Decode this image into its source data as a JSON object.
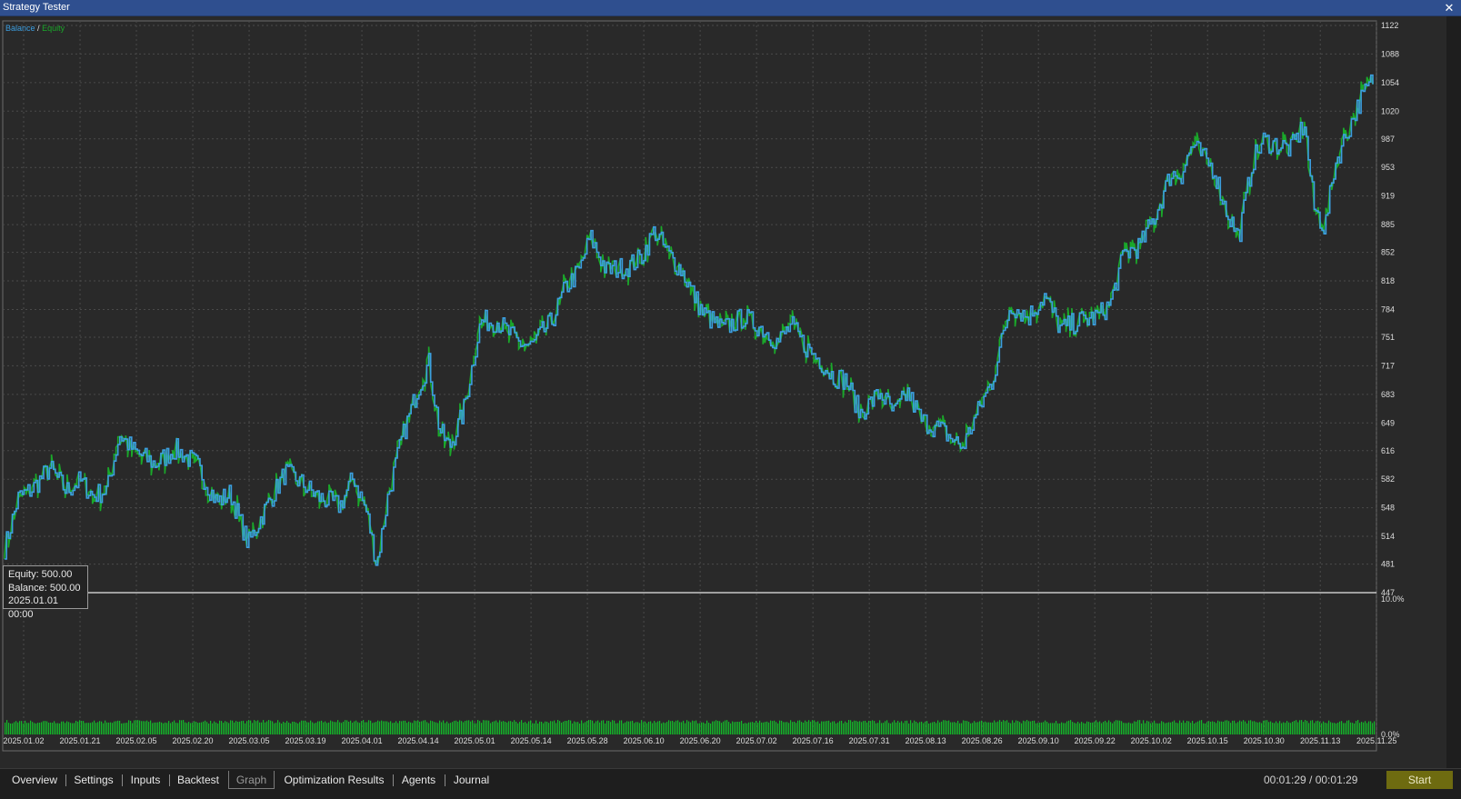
{
  "window": {
    "title": "Strategy Tester",
    "close_icon": "close-icon"
  },
  "legend": {
    "balance": "Balance",
    "separator": "/",
    "equity": "Equity"
  },
  "colors": {
    "balance": "#3c9ee0",
    "equity": "#1aa82a",
    "background": "#292929",
    "grid": "#4a4a4a",
    "start_button": "#6e6b10"
  },
  "infobox": {
    "equity": "Equity: 500.00",
    "balance": "Balance: 500.00",
    "datetime": "2025.01.01 00:00"
  },
  "tabs": [
    {
      "label": "Overview"
    },
    {
      "label": "Settings"
    },
    {
      "label": "Inputs"
    },
    {
      "label": "Backtest"
    },
    {
      "label": "Graph",
      "active": true
    },
    {
      "label": "Optimization Results"
    },
    {
      "label": "Agents"
    },
    {
      "label": "Journal"
    }
  ],
  "status": {
    "timer": "00:01:29 / 00:01:29",
    "start_label": "Start"
  },
  "chart_data": {
    "type": "line",
    "title": "",
    "series": [
      {
        "name": "Balance",
        "color": "#3c9ee0"
      },
      {
        "name": "Equity",
        "color": "#1aa82a"
      }
    ],
    "ylim": [
      447,
      1122
    ],
    "y_ticks": [
      "1122",
      "1088",
      "1054",
      "1020",
      "987",
      "953",
      "919",
      "885",
      "852",
      "818",
      "784",
      "751",
      "717",
      "683",
      "649",
      "616",
      "582",
      "548",
      "514",
      "481",
      "447"
    ],
    "x_ticks": [
      "2025.01.02",
      "2025.01.21",
      "2025.02.05",
      "2025.02.20",
      "2025.03.05",
      "2025.03.19",
      "2025.04.01",
      "2025.04.14",
      "2025.05.01",
      "2025.05.14",
      "2025.05.28",
      "2025.06.10",
      "2025.06.20",
      "2025.07.02",
      "2025.07.16",
      "2025.07.31",
      "2025.08.13",
      "2025.08.26",
      "2025.09.10",
      "2025.09.22",
      "2025.10.02",
      "2025.10.15",
      "2025.10.30",
      "2025.11.13",
      "2025.11.25"
    ],
    "profile": [
      [
        0,
        500
      ],
      [
        0.01,
        560
      ],
      [
        0.02,
        570
      ],
      [
        0.033,
        595
      ],
      [
        0.045,
        568
      ],
      [
        0.055,
        580
      ],
      [
        0.065,
        562
      ],
      [
        0.075,
        570
      ],
      [
        0.084,
        635
      ],
      [
        0.095,
        615
      ],
      [
        0.11,
        600
      ],
      [
        0.125,
        618
      ],
      [
        0.14,
        600
      ],
      [
        0.155,
        555
      ],
      [
        0.165,
        565
      ],
      [
        0.178,
        505
      ],
      [
        0.19,
        545
      ],
      [
        0.205,
        590
      ],
      [
        0.215,
        580
      ],
      [
        0.23,
        560
      ],
      [
        0.245,
        550
      ],
      [
        0.255,
        585
      ],
      [
        0.265,
        540
      ],
      [
        0.272,
        480
      ],
      [
        0.28,
        560
      ],
      [
        0.29,
        628
      ],
      [
        0.302,
        690
      ],
      [
        0.31,
        720
      ],
      [
        0.318,
        640
      ],
      [
        0.325,
        620
      ],
      [
        0.335,
        660
      ],
      [
        0.348,
        770
      ],
      [
        0.36,
        770
      ],
      [
        0.375,
        745
      ],
      [
        0.385,
        740
      ],
      [
        0.392,
        755
      ],
      [
        0.4,
        770
      ],
      [
        0.41,
        810
      ],
      [
        0.42,
        830
      ],
      [
        0.428,
        870
      ],
      [
        0.44,
        830
      ],
      [
        0.455,
        835
      ],
      [
        0.465,
        845
      ],
      [
        0.475,
        878
      ],
      [
        0.485,
        850
      ],
      [
        0.495,
        830
      ],
      [
        0.51,
        780
      ],
      [
        0.525,
        760
      ],
      [
        0.54,
        775
      ],
      [
        0.555,
        760
      ],
      [
        0.565,
        745
      ],
      [
        0.575,
        765
      ],
      [
        0.585,
        740
      ],
      [
        0.595,
        725
      ],
      [
        0.605,
        705
      ],
      [
        0.615,
        700
      ],
      [
        0.625,
        660
      ],
      [
        0.64,
        685
      ],
      [
        0.65,
        660
      ],
      [
        0.66,
        685
      ],
      [
        0.67,
        652
      ],
      [
        0.685,
        640
      ],
      [
        0.7,
        620
      ],
      [
        0.712,
        665
      ],
      [
        0.722,
        700
      ],
      [
        0.735,
        790
      ],
      [
        0.748,
        775
      ],
      [
        0.76,
        800
      ],
      [
        0.772,
        760
      ],
      [
        0.785,
        770
      ],
      [
        0.798,
        775
      ],
      [
        0.808,
        790
      ],
      [
        0.818,
        850
      ],
      [
        0.83,
        860
      ],
      [
        0.842,
        900
      ],
      [
        0.852,
        945
      ],
      [
        0.86,
        945
      ],
      [
        0.868,
        980
      ],
      [
        0.876,
        965
      ],
      [
        0.884,
        950
      ],
      [
        0.892,
        905
      ],
      [
        0.902,
        870
      ],
      [
        0.912,
        960
      ],
      [
        0.92,
        985
      ],
      [
        0.93,
        980
      ],
      [
        0.94,
        975
      ],
      [
        0.95,
        1005
      ],
      [
        0.957,
        905
      ],
      [
        0.965,
        880
      ],
      [
        0.972,
        955
      ],
      [
        0.98,
        990
      ],
      [
        0.99,
        1030
      ],
      [
        1.0,
        1058
      ]
    ]
  }
}
